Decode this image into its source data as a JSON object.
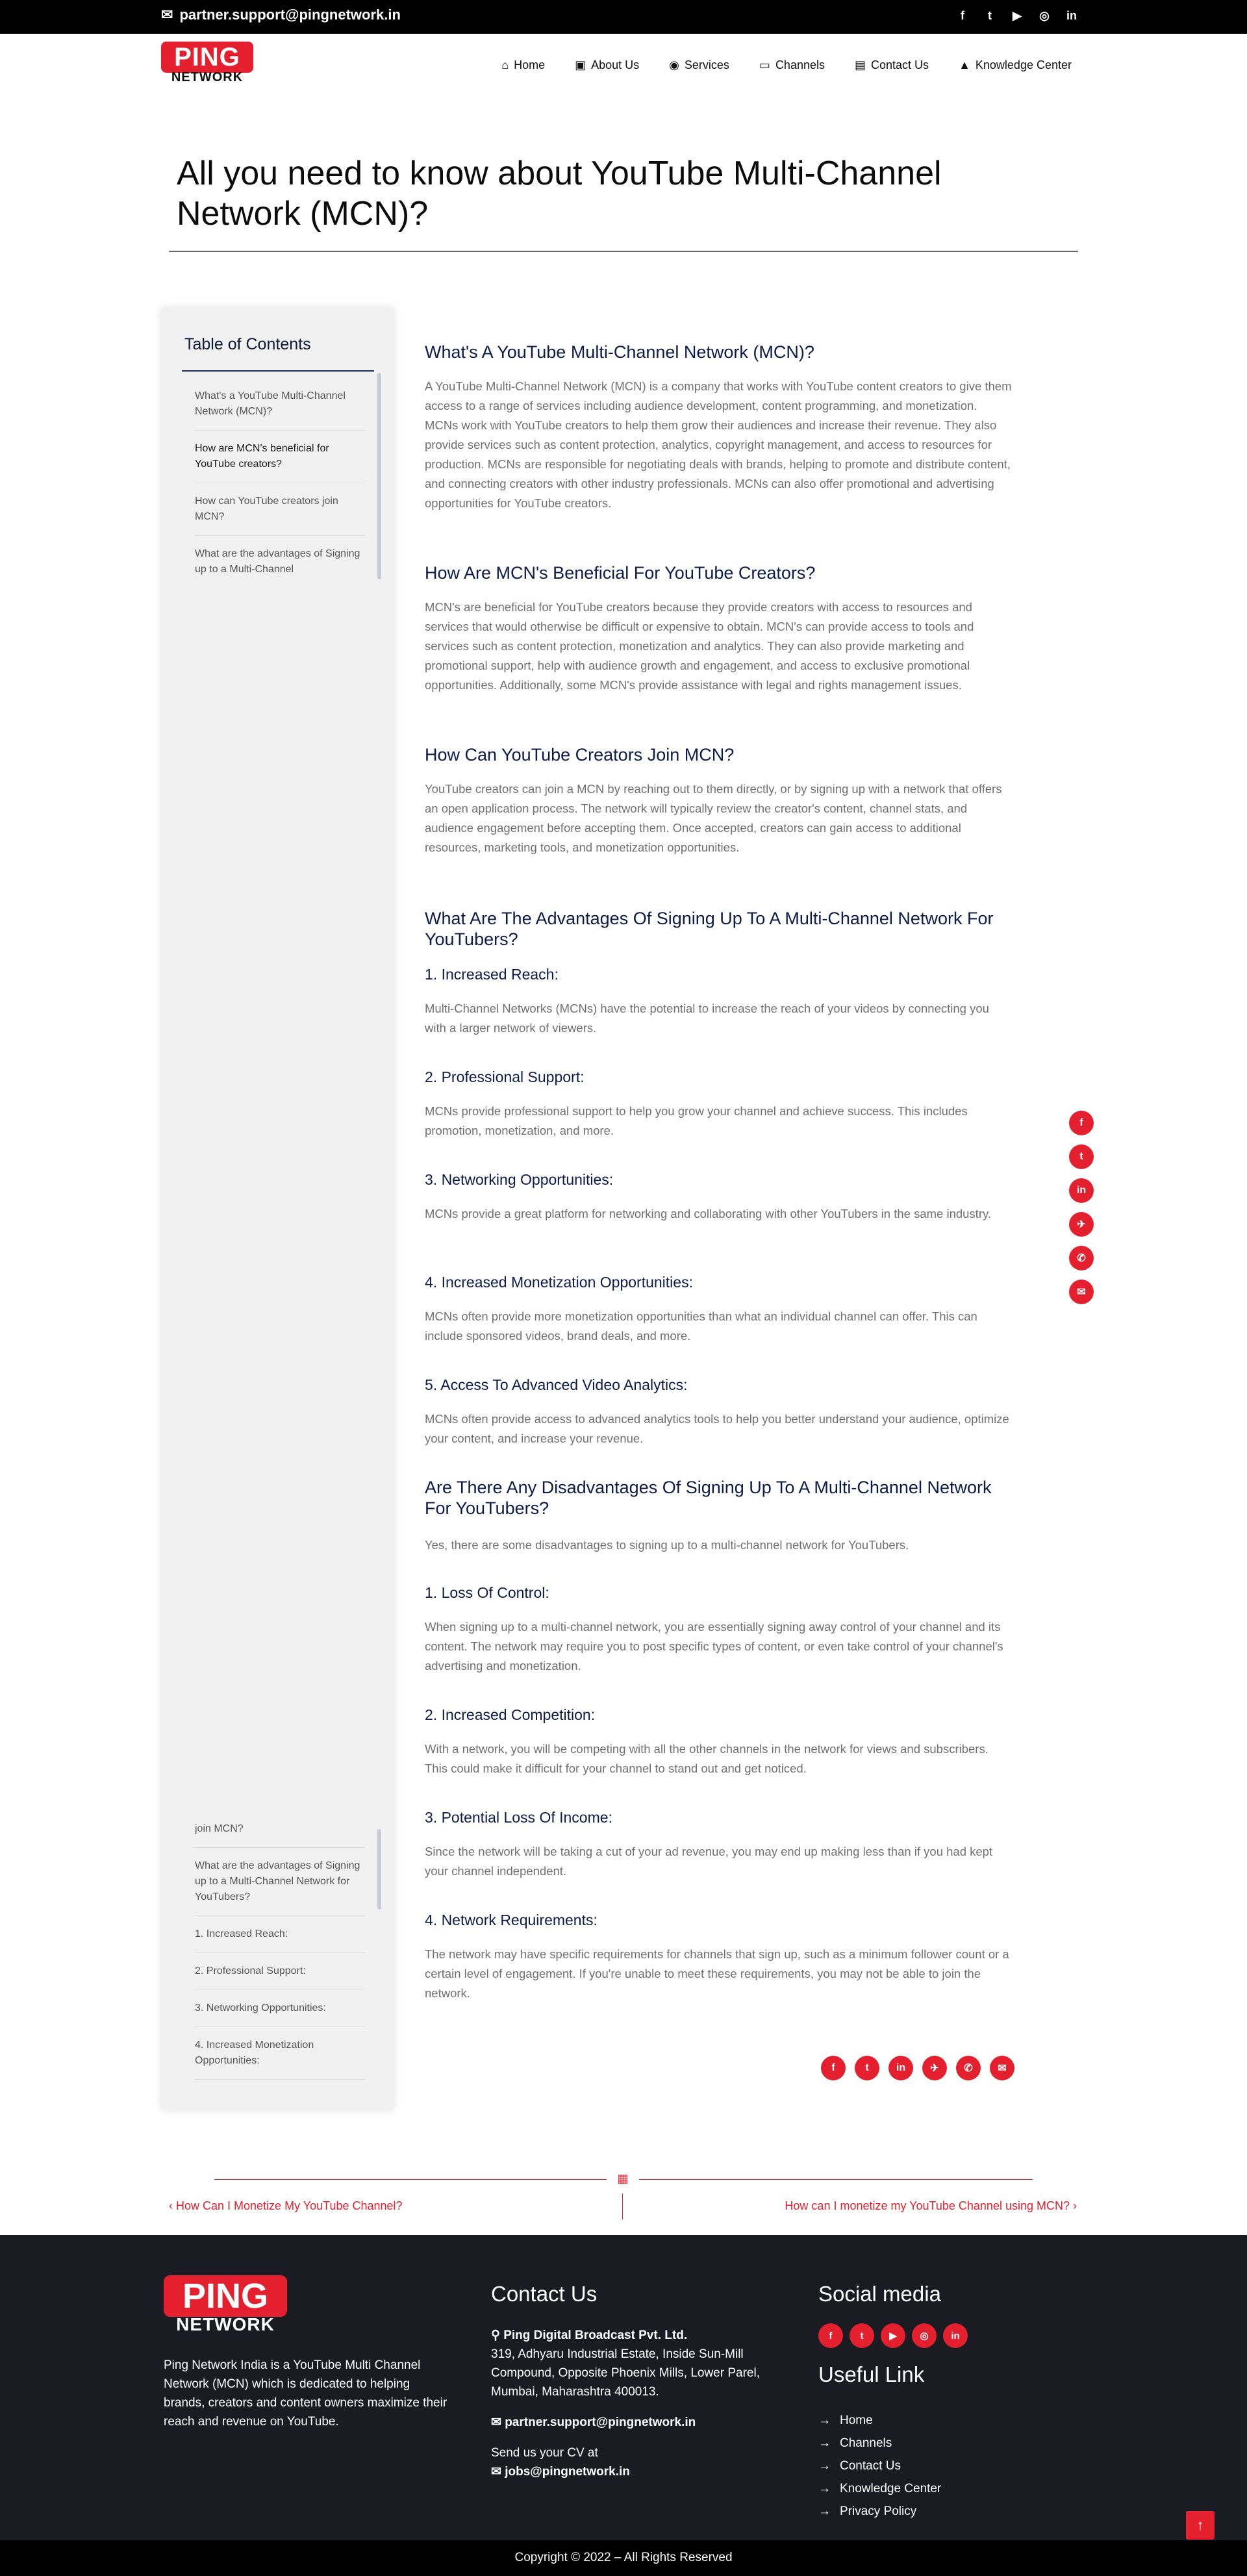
{
  "topbar": {
    "email": "partner.support@pingnetwork.in",
    "social": [
      "f",
      "t",
      "▶",
      "◎",
      "in"
    ]
  },
  "header": {
    "logo_top": "PING",
    "logo_bottom": "NETWORK",
    "nav": [
      "Home",
      "About Us",
      "Services",
      "Channels",
      "Contact Us",
      "Knowledge Center"
    ]
  },
  "page": {
    "title": "All you need to know about YouTube Multi-Channel Network (MCN)?"
  },
  "toc": {
    "title": "Table of Contents",
    "top_items": [
      "What's a YouTube Multi-Channel Network (MCN)?",
      "How are MCN's beneficial for YouTube creators?",
      "How can YouTube creators join MCN?",
      "What are the advantages of Signing up to a Multi-Channel"
    ],
    "bottom_items": [
      "join MCN?",
      "What are the advantages of Signing up to a Multi-Channel Network for YouTubers?",
      "1. Increased Reach:",
      "2. Professional Support:",
      "3. Networking Opportunities:",
      "4. Increased Monetization Opportunities:"
    ]
  },
  "article": {
    "h_what": "What's A YouTube Multi-Channel Network (MCN)?",
    "p_what": "A YouTube Multi-Channel Network (MCN) is a company that works with YouTube content creators to give them access to a range of services including audience development, content programming, and monetization. MCNs work with YouTube creators to help them grow their audiences and increase their revenue. They also provide services such as content protection, analytics, copyright management, and access to resources for production. MCNs are responsible for negotiating deals with brands, helping to promote and distribute content, and connecting creators with other industry professionals. MCNs can also offer promotional and advertising opportunities for YouTube creators.",
    "h_benefit": "How Are MCN's Beneficial For YouTube Creators?",
    "p_benefit": "MCN's are beneficial for YouTube creators because they provide creators with access to resources and services that would otherwise be difficult or expensive to obtain. MCN's can provide access to tools and services such as content protection, monetization and analytics. They can also provide marketing and promotional support, help with audience growth and engagement, and access to exclusive promotional opportunities. Additionally, some MCN's provide assistance with legal and rights management issues.",
    "h_join": "How Can YouTube Creators Join MCN?",
    "p_join": "YouTube creators can join a MCN by reaching out to them directly, or by signing up with a network that offers an open application process. The network will typically review the creator's content, channel stats, and audience engagement before accepting them. Once accepted, creators can gain access to additional resources, marketing tools, and monetization opportunities.",
    "h_adv": "What Are The Advantages Of Signing Up To A Multi-Channel Network For YouTubers?",
    "adv": [
      {
        "h": "1. Increased Reach:",
        "p": "Multi-Channel Networks (MCNs) have the potential to increase the reach of your videos by connecting you with a larger network of viewers."
      },
      {
        "h": "2. Professional Support:",
        "p": "MCNs provide professional support to help you grow your channel and achieve success. This includes promotion, monetization, and more."
      },
      {
        "h": "3. Networking Opportunities:",
        "p": "MCNs provide a great platform for networking and collaborating with other YouTubers in the same industry."
      },
      {
        "h": "4. Increased Monetization Opportunities:",
        "p": "MCNs often provide more monetization opportunities than what an individual channel can offer. This can include sponsored videos, brand deals, and more."
      },
      {
        "h": "5. Access To Advanced Video Analytics:",
        "p": "MCNs often provide access to advanced analytics tools to help you better understand your audience, optimize your content, and increase your revenue."
      }
    ],
    "h_dis": "Are There Any Disadvantages Of Signing Up To A Multi-Channel Network For YouTubers?",
    "p_dis": "Yes, there are some disadvantages to signing up to a multi-channel network for YouTubers.",
    "dis": [
      {
        "h": "1. Loss Of Control:",
        "p": "When signing up to a multi-channel network, you are essentially signing away control of your channel and its content. The network may require you to post specific types of content, or even take control of your channel's advertising and monetization."
      },
      {
        "h": "2. Increased Competition:",
        "p": "With a network, you will be competing with all the other channels in the network for views and subscribers. This could make it difficult for your channel to stand out and get noticed."
      },
      {
        "h": "3. Potential Loss Of Income:",
        "p": "Since the network will be taking a cut of your ad revenue, you may end up making less than if you had kept your channel independent."
      },
      {
        "h": "4. Network Requirements:",
        "p": "The network may have specific requirements for channels that sign up, such as a minimum follower count or a certain level of engagement. If you're unable to meet these requirements, you may not be able to join the network."
      }
    ]
  },
  "share": [
    "f",
    "t",
    "in",
    "✈",
    "✆",
    "✉"
  ],
  "postnav": {
    "prev": "How Can I Monetize My YouTube Channel?",
    "next": "How can I monetize my YouTube Channel using MCN?"
  },
  "footer": {
    "logo_top": "PING",
    "logo_bottom": "NETWORK",
    "about": "Ping Network India is a YouTube Multi Channel Network (MCN) which is dedicated to helping brands, creators and content owners maximize their reach and revenue on YouTube.",
    "contact_heading": "Contact Us",
    "company": "Ping Digital Broadcast Pvt. Ltd.",
    "address": "319, Adhyaru Industrial Estate, Inside Sun-Mill Compound, Opposite Phoenix Mills, Lower Parel, Mumbai, Maharashtra 400013.",
    "email": "partner.support@pingnetwork.in",
    "cv_label": "Send us your CV at",
    "cv_email": "jobs@pingnetwork.in",
    "social_heading": "Social media",
    "social": [
      "f",
      "t",
      "▶",
      "◎",
      "in"
    ],
    "links_heading": "Useful Link",
    "links": [
      "Home",
      "Channels",
      "Contact Us",
      "Knowledge Center",
      "Privacy Policy"
    ],
    "copyright": "Copyright © 2022 – All Rights Reserved"
  },
  "colors": {
    "accent": "#e5202e",
    "heading": "#0d1b4a",
    "footer_bg": "#1a1b23"
  }
}
